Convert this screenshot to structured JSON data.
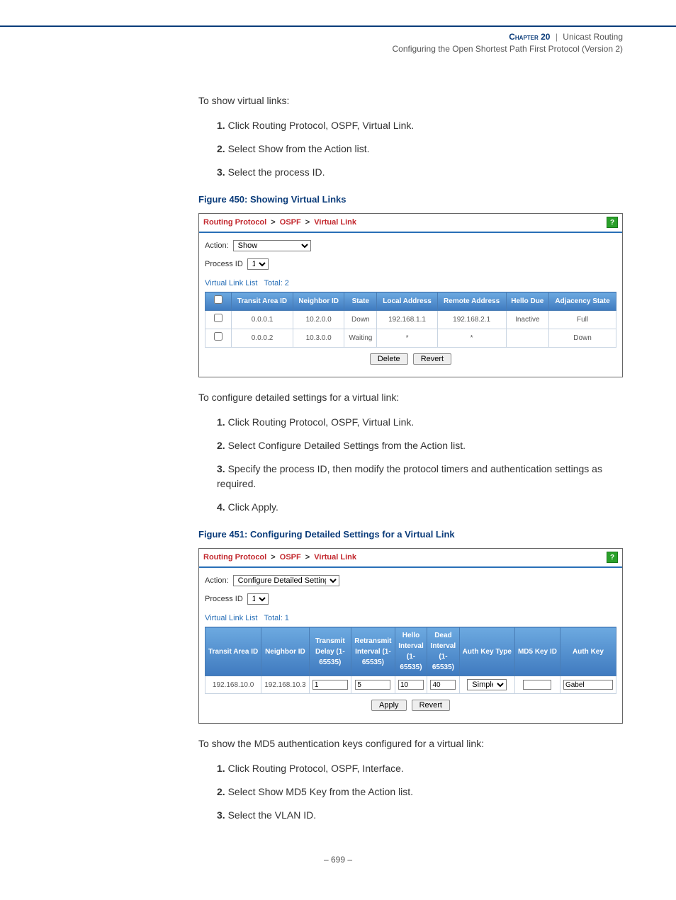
{
  "header": {
    "chapter": "Chapter 20",
    "section": "Unicast Routing",
    "subsection": "Configuring the Open Shortest Path First Protocol (Version 2)"
  },
  "body": {
    "intro1": "To show virtual links:",
    "steps1": [
      "Click Routing Protocol, OSPF, Virtual Link.",
      "Select Show from the Action list.",
      "Select the process ID."
    ],
    "fig1_label": "Figure 450:  Showing Virtual Links",
    "intro2": "To configure detailed settings for a virtual link:",
    "steps2": [
      "Click Routing Protocol, OSPF, Virtual Link.",
      "Select Configure Detailed Settings from the Action list.",
      "Specify the process ID, then modify the protocol timers and authentication settings as required.",
      "Click Apply."
    ],
    "fig2_label": "Figure 451:  Configuring Detailed Settings for a Virtual Link",
    "intro3": "To show the MD5 authentication keys configured for a virtual link:",
    "steps3": [
      "Click Routing Protocol, OSPF, Interface.",
      "Select Show MD5 Key from the Action list.",
      "Select the VLAN ID."
    ]
  },
  "panel1": {
    "breadcrumb": [
      "Routing Protocol",
      "OSPF",
      "Virtual Link"
    ],
    "action_label": "Action:",
    "action_value": "Show",
    "process_label": "Process ID",
    "process_value": "1",
    "list_label": "Virtual Link List",
    "list_total": "Total: 2",
    "headers": [
      "",
      "Transit Area ID",
      "Neighbor ID",
      "State",
      "Local Address",
      "Remote Address",
      "Hello Due",
      "Adjacency State"
    ],
    "rows": [
      {
        "transit": "0.0.0.1",
        "neighbor": "10.2.0.0",
        "state": "Down",
        "local": "192.168.1.1",
        "remote": "192.168.2.1",
        "hello": "Inactive",
        "adj": "Full"
      },
      {
        "transit": "0.0.0.2",
        "neighbor": "10.3.0.0",
        "state": "Waiting",
        "local": "*",
        "remote": "*",
        "hello": "",
        "adj": "Down"
      }
    ],
    "buttons": {
      "delete": "Delete",
      "revert": "Revert"
    }
  },
  "panel2": {
    "breadcrumb": [
      "Routing Protocol",
      "OSPF",
      "Virtual Link"
    ],
    "action_label": "Action:",
    "action_value": "Configure Detailed Settings",
    "process_label": "Process ID",
    "process_value": "1",
    "list_label": "Virtual Link List",
    "list_total": "Total: 1",
    "headers": [
      "Transit Area ID",
      "Neighbor ID",
      "Transmit Delay (1-65535)",
      "Retransmit Interval (1-65535)",
      "Hello Interval (1-65535)",
      "Dead Interval (1-65535)",
      "Auth Key Type",
      "MD5 Key ID",
      "Auth Key"
    ],
    "row": {
      "transit": "192.168.10.0",
      "neighbor": "192.168.10.3",
      "tx": "1",
      "rtx": "5",
      "hello": "10",
      "dead": "40",
      "authtype": "Simple",
      "md5": "",
      "authkey": "Gabel"
    },
    "buttons": {
      "apply": "Apply",
      "revert": "Revert"
    }
  },
  "footer": {
    "page": "–  699  –"
  }
}
